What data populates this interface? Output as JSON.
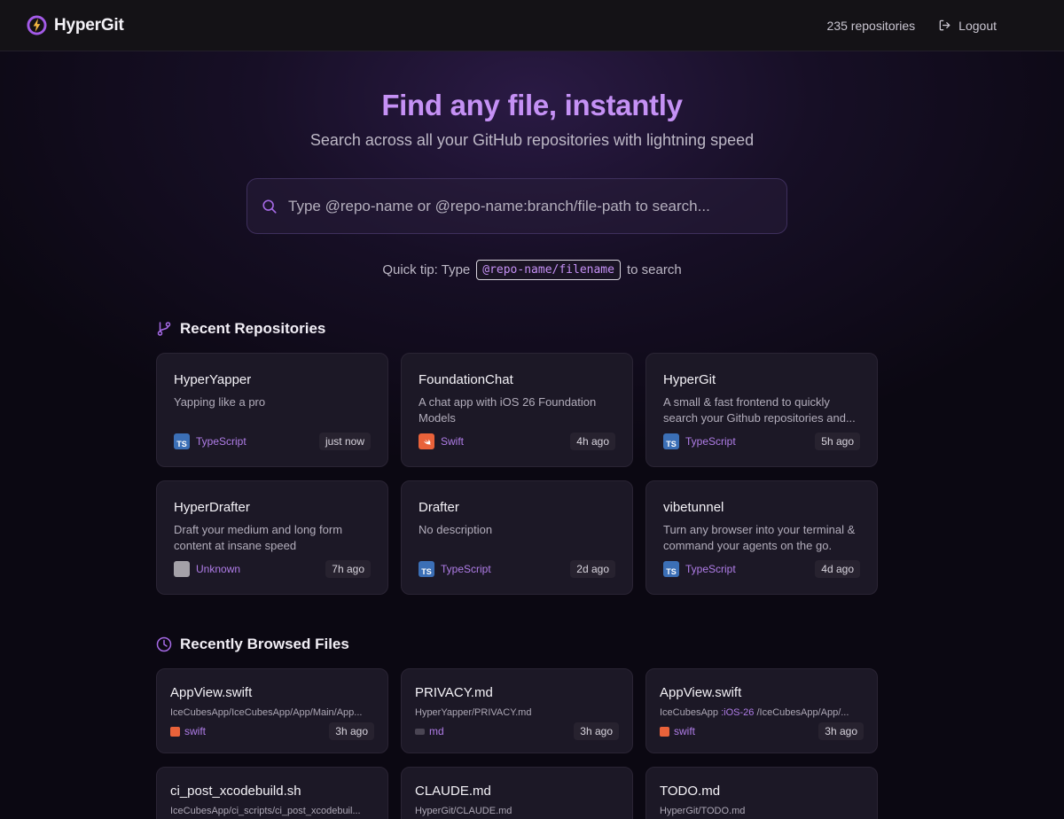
{
  "header": {
    "brand": "HyperGit",
    "repo_count": "235 repositories",
    "logout_label": "Logout"
  },
  "hero": {
    "title": "Find any file, instantly",
    "subtitle": "Search across all your GitHub repositories with lightning speed"
  },
  "search": {
    "placeholder": "Type @repo-name or @repo-name:branch/file-path to search..."
  },
  "tip": {
    "prefix": "Quick tip: Type",
    "code": "@repo-name/filename",
    "suffix": "to search"
  },
  "recent_repos": {
    "heading": "Recent Repositories",
    "items": [
      {
        "name": "HyperYapper",
        "description": "Yapping like a pro",
        "language": "TypeScript",
        "lang_icon": "TS",
        "time": "just now"
      },
      {
        "name": "FoundationChat",
        "description": "A chat app with iOS 26 Foundation Models",
        "language": "Swift",
        "lang_icon": "swift",
        "time": "4h ago"
      },
      {
        "name": "HyperGit",
        "description": "A small & fast frontend to quickly search your Github repositories and...",
        "language": "TypeScript",
        "lang_icon": "TS",
        "time": "5h ago"
      },
      {
        "name": "HyperDrafter",
        "description": "Draft your medium and long form content at insane speed",
        "language": "Unknown",
        "lang_icon": "unknown",
        "time": "7h ago"
      },
      {
        "name": "Drafter",
        "description": "No description",
        "language": "TypeScript",
        "lang_icon": "TS",
        "time": "2d ago"
      },
      {
        "name": "vibetunnel",
        "description": "Turn any browser into your terminal & command your agents on the go.",
        "language": "TypeScript",
        "lang_icon": "TS",
        "time": "4d ago"
      }
    ]
  },
  "recent_files": {
    "heading": "Recently Browsed Files",
    "items": [
      {
        "name": "AppView.swift",
        "path": "IceCubesApp/IceCubesApp/App/Main/App...",
        "branch": "",
        "path_rest": "",
        "type": "swift",
        "time": "3h ago"
      },
      {
        "name": "PRIVACY.md",
        "path": "HyperYapper/PRIVACY.md",
        "branch": "",
        "path_rest": "",
        "type": "md",
        "time": "3h ago"
      },
      {
        "name": "AppView.swift",
        "path": "IceCubesApp ",
        "branch": ":iOS-26",
        "path_rest": " /IceCubesApp/App/...",
        "type": "swift",
        "time": "3h ago"
      },
      {
        "name": "ci_post_xcodebuild.sh",
        "path": "IceCubesApp/ci_scripts/ci_post_xcodebuil...",
        "branch": "",
        "path_rest": "",
        "type": "",
        "time": ""
      },
      {
        "name": "CLAUDE.md",
        "path": "HyperGit/CLAUDE.md",
        "branch": "",
        "path_rest": "",
        "type": "",
        "time": ""
      },
      {
        "name": "TODO.md",
        "path": "HyperGit/TODO.md",
        "branch": "",
        "path_rest": "",
        "type": "",
        "time": ""
      }
    ]
  },
  "colors": {
    "accent": "#c591f5",
    "language_link": "#b07de8",
    "typescript": "#3b6fb6",
    "swift": "#e9623a"
  }
}
